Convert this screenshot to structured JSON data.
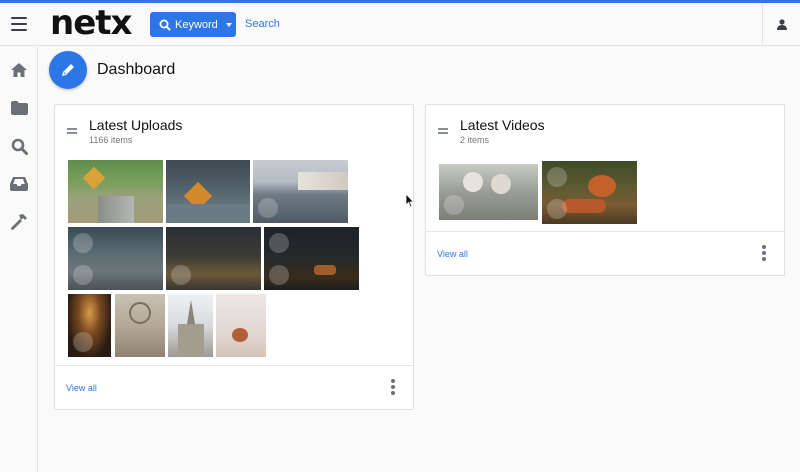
{
  "app": {
    "logo": "netx"
  },
  "header": {
    "keyword_label": "Keyword",
    "search_link": "Search"
  },
  "sidebar": {
    "items": [
      {
        "name": "home-icon"
      },
      {
        "name": "folder-icon"
      },
      {
        "name": "search-icon"
      },
      {
        "name": "inbox-icon"
      },
      {
        "name": "hammer-icon"
      }
    ]
  },
  "page": {
    "title": "Dashboard"
  },
  "uploads": {
    "title": "Latest Uploads",
    "count": "1166 items",
    "view_all": "View all"
  },
  "videos": {
    "title": "Latest Videos",
    "count": "2 items",
    "view_all": "View all"
  },
  "colors": {
    "accent": "#2d76e6"
  }
}
